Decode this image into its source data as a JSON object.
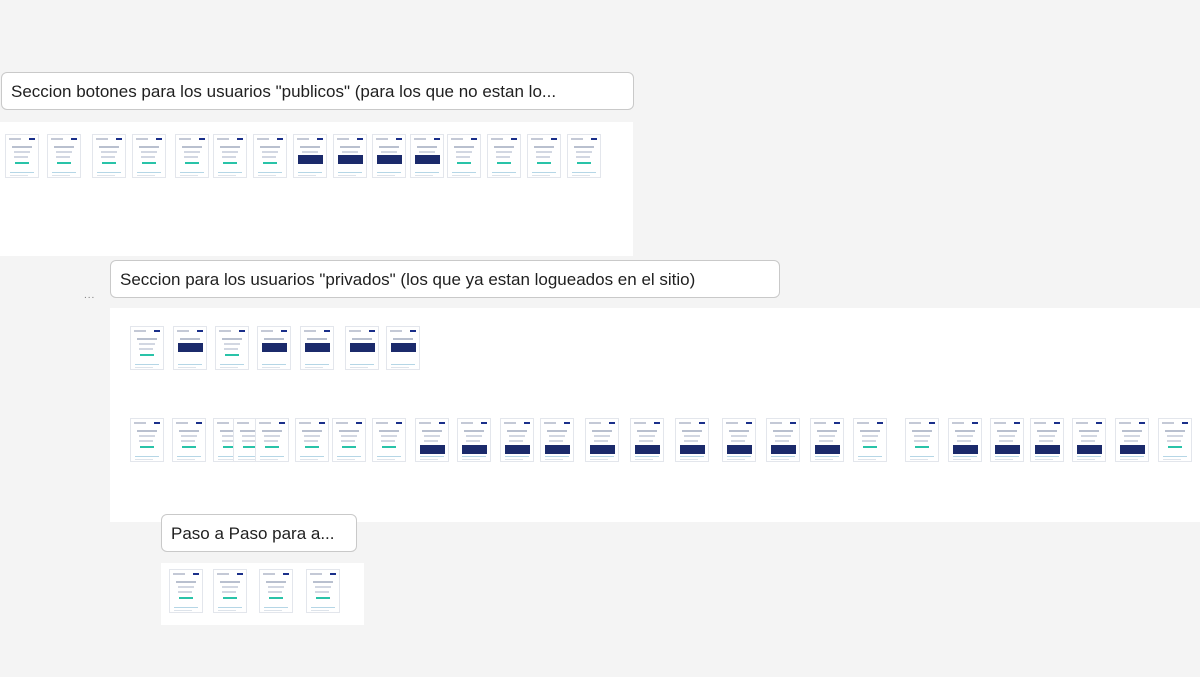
{
  "canvas": {
    "sections": [
      {
        "id": "publicos",
        "label": "Seccion botones para los usuarios \"publicos\" (para los que no estan lo..."
      },
      {
        "id": "privados",
        "label": "Seccion para los usuarios \"privados\" (los que ya estan logueados en el sitio)"
      },
      {
        "id": "paso",
        "label": "Paso a Paso para a..."
      }
    ],
    "ellipsis": "..."
  },
  "colors": {
    "canvas_bg": "#f4f4f4",
    "frame_dark": "#1b2a6b",
    "frame_accent": "#29c3a8"
  }
}
